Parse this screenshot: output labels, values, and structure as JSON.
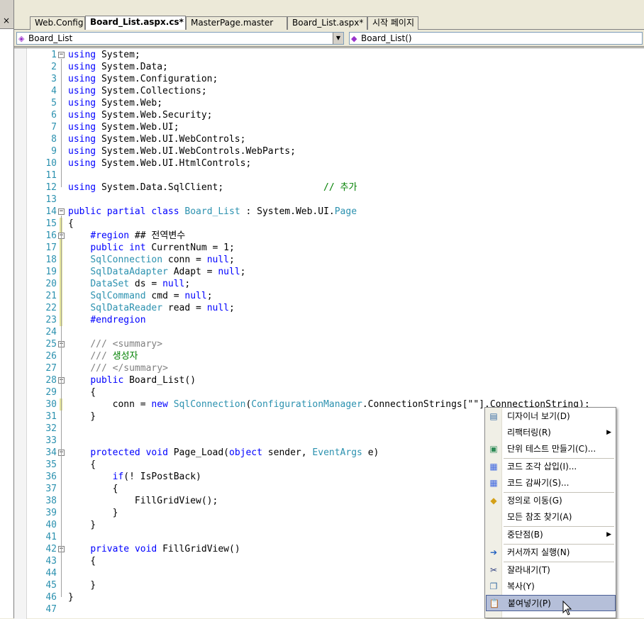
{
  "window": {
    "close_glyph": "×"
  },
  "tabs": [
    {
      "label": "Web.Config",
      "active": false
    },
    {
      "label": "Board_List.aspx.cs*",
      "active": true
    },
    {
      "label": "MasterPage.master",
      "active": false
    },
    {
      "label": "Board_List.aspx*",
      "active": false
    },
    {
      "label": "시작 페이지",
      "active": false
    }
  ],
  "dropdowns": {
    "class_combo": {
      "value": "Board_List",
      "icon": "class-icon"
    },
    "member_combo": {
      "value": "Board_List()",
      "icon": "method-icon"
    }
  },
  "code_lines": [
    {
      "n": "1",
      "t": "using System;"
    },
    {
      "n": "2",
      "t": "using System.Data;"
    },
    {
      "n": "3",
      "t": "using System.Configuration;"
    },
    {
      "n": "4",
      "t": "using System.Collections;"
    },
    {
      "n": "5",
      "t": "using System.Web;"
    },
    {
      "n": "6",
      "t": "using System.Web.Security;"
    },
    {
      "n": "7",
      "t": "using System.Web.UI;"
    },
    {
      "n": "8",
      "t": "using System.Web.UI.WebControls;"
    },
    {
      "n": "9",
      "t": "using System.Web.UI.WebControls.WebParts;"
    },
    {
      "n": "10",
      "t": "using System.Web.UI.HtmlControls;"
    },
    {
      "n": "11",
      "t": ""
    },
    {
      "n": "12",
      "t": "using System.Data.SqlClient;                  // 추가"
    },
    {
      "n": "13",
      "t": ""
    },
    {
      "n": "14",
      "t": "public partial class Board_List : System.Web.UI.Page"
    },
    {
      "n": "15",
      "t": "{"
    },
    {
      "n": "16",
      "t": "    #region ## 전역변수"
    },
    {
      "n": "17",
      "t": "    public int CurrentNum = 1;"
    },
    {
      "n": "18",
      "t": "    SqlConnection conn = null;"
    },
    {
      "n": "19",
      "t": "    SqlDataAdapter Adapt = null;"
    },
    {
      "n": "20",
      "t": "    DataSet ds = null;"
    },
    {
      "n": "21",
      "t": "    SqlCommand cmd = null;"
    },
    {
      "n": "22",
      "t": "    SqlDataReader read = null;"
    },
    {
      "n": "23",
      "t": "    #endregion"
    },
    {
      "n": "24",
      "t": ""
    },
    {
      "n": "25",
      "t": "    /// <summary>"
    },
    {
      "n": "26",
      "t": "    /// 생성자"
    },
    {
      "n": "27",
      "t": "    /// </summary>"
    },
    {
      "n": "28",
      "t": "    public Board_List()"
    },
    {
      "n": "29",
      "t": "    {"
    },
    {
      "n": "30",
      "t": "        conn = new SqlConnection(ConfigurationManager.ConnectionStrings[\"\"].ConnectionString);"
    },
    {
      "n": "31",
      "t": "    }"
    },
    {
      "n": "32",
      "t": ""
    },
    {
      "n": "33",
      "t": ""
    },
    {
      "n": "34",
      "t": "    protected void Page_Load(object sender, EventArgs e)"
    },
    {
      "n": "35",
      "t": "    {"
    },
    {
      "n": "36",
      "t": "        if(! IsPostBack)"
    },
    {
      "n": "37",
      "t": "        {"
    },
    {
      "n": "38",
      "t": "            FillGridView();"
    },
    {
      "n": "39",
      "t": "        }"
    },
    {
      "n": "40",
      "t": "    }"
    },
    {
      "n": "41",
      "t": ""
    },
    {
      "n": "42",
      "t": "    private void FillGridView()"
    },
    {
      "n": "43",
      "t": "    {"
    },
    {
      "n": "44",
      "t": ""
    },
    {
      "n": "45",
      "t": "    }"
    },
    {
      "n": "46",
      "t": "}"
    },
    {
      "n": "47",
      "t": ""
    }
  ],
  "context_menu": {
    "items": [
      {
        "label": "디자이너 보기(D)",
        "icon": "designer-view-icon",
        "glyph": "▤",
        "color": "#3a6ea5"
      },
      {
        "label": "리팩터링(R)",
        "submenu": true
      },
      {
        "label": "단위 테스트 만들기(C)...",
        "icon": "unit-test-icon",
        "glyph": "▣",
        "color": "#2e8b57"
      },
      {
        "sep": true
      },
      {
        "label": "코드 조각 삽입(I)...",
        "icon": "insert-snippet-icon",
        "glyph": "▦",
        "color": "#4169e1"
      },
      {
        "label": "코드 감싸기(S)...",
        "icon": "surround-with-icon",
        "glyph": "▦",
        "color": "#4169e1"
      },
      {
        "sep": true
      },
      {
        "label": "정의로 이동(G)",
        "icon": "go-to-definition-icon",
        "glyph": "◆",
        "color": "#d4a017"
      },
      {
        "label": "모든 참조 찾기(A)"
      },
      {
        "sep": true
      },
      {
        "label": "중단점(B)",
        "submenu": true
      },
      {
        "sep": true
      },
      {
        "label": "커서까지 실행(N)",
        "icon": "run-to-cursor-icon",
        "glyph": "➔",
        "color": "#1f5fbf"
      },
      {
        "sep": true
      },
      {
        "label": "잘라내기(T)",
        "icon": "cut-icon",
        "glyph": "✂",
        "color": "#304080"
      },
      {
        "label": "복사(Y)",
        "icon": "copy-icon",
        "glyph": "❐",
        "color": "#3a6ea5"
      },
      {
        "label": "붙여넣기(P)",
        "icon": "paste-icon",
        "glyph": "📋",
        "color": "#b8860b",
        "highlighted": true
      }
    ],
    "submenu_arrow": "▶"
  }
}
